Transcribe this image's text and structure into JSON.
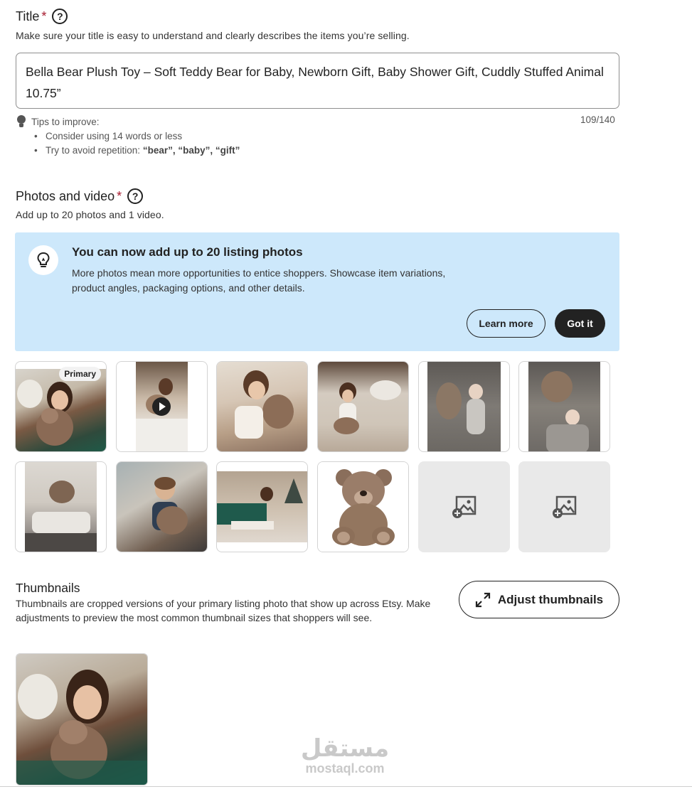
{
  "title_section": {
    "label": "Title",
    "required_mark": "*",
    "help_icon": "question-circle-icon",
    "helper": "Make sure your title is easy to understand and clearly describes the items you’re selling.",
    "value": "Bella Bear Plush Toy – Soft Teddy Bear for Baby, Newborn Gift, Baby Shower Gift, Cuddly Stuffed Animal 10.75”",
    "tips_label": "Tips to improve:",
    "tips": {
      "tip1": "Consider using 14 words or less",
      "tip2_prefix": "Try to avoid repetition: ",
      "tip2_terms": "“bear”, “baby”, “gift”"
    },
    "counter": "109/140"
  },
  "photos_section": {
    "label": "Photos and video",
    "required_mark": "*",
    "help_icon": "question-circle-icon",
    "helper": "Add up to 20 photos and 1 video.",
    "banner": {
      "icon": "lightbulb-icon",
      "title": "You can now add up to 20 listing photos",
      "text": "More photos mean more opportunities to entice shoppers. Showcase item variations, product angles, packaging options, and other details.",
      "learn_more": "Learn more",
      "got_it": "Got it"
    },
    "primary_badge": "Primary",
    "add_photo_icon": "add-image-icon",
    "play_icon": "play-icon"
  },
  "thumbnails_section": {
    "label": "Thumbnails",
    "text": "Thumbnails are cropped versions of your primary listing photo that show up across Etsy. Make adjustments to preview the most common thumbnail sizes that shoppers will see.",
    "adjust_button": "Adjust thumbnails",
    "adjust_icon": "expand-arrows-icon"
  },
  "watermark": {
    "arabic": "مستقل",
    "latin": "mostaql.com"
  }
}
